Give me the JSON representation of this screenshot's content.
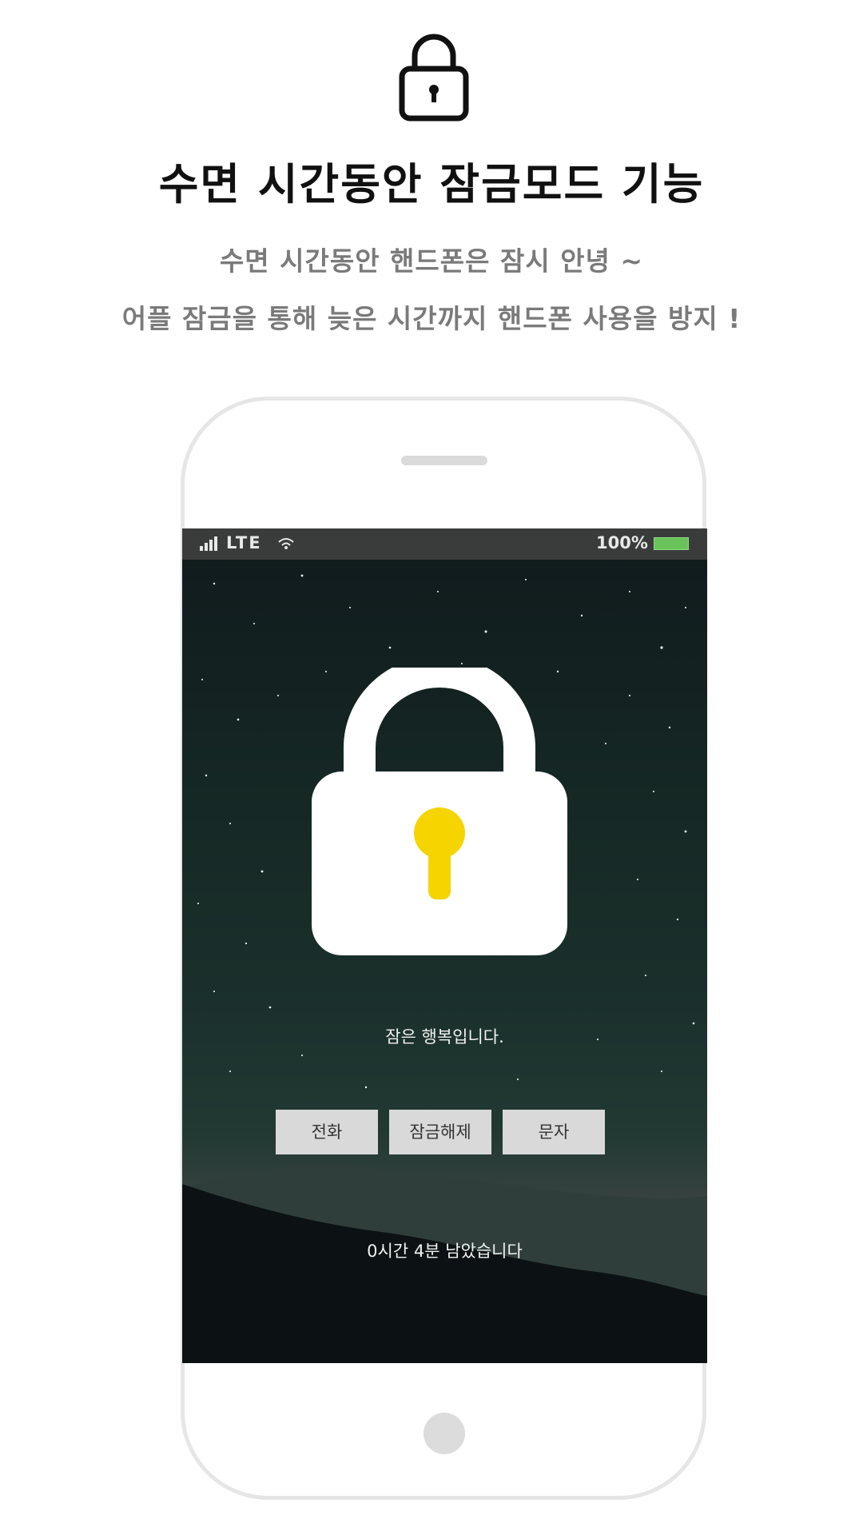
{
  "header": {
    "icon": "lock-icon",
    "title": "수면 시간동안 잠금모드 기능",
    "subtitle_line1": "수면 시간동안 핸드폰은 잠시 안녕 ~",
    "subtitle_line2": "어플 잠금을 통해 늦은 시간까지 핸드폰 사용을 방지 !"
  },
  "status_bar": {
    "network": "LTE",
    "battery": "100%",
    "icons": [
      "signal-icon",
      "wifi-icon",
      "battery-icon"
    ],
    "battery_color": "#6ac35a"
  },
  "lock_screen": {
    "lock_icon": "padlock-icon",
    "keyhole_color": "#f5d400",
    "message": "잠은 행복입니다.",
    "buttons": {
      "call": "전화",
      "unlock": "잠금해제",
      "text": "문자"
    },
    "remaining": "0시간 4분 남았습니다"
  }
}
